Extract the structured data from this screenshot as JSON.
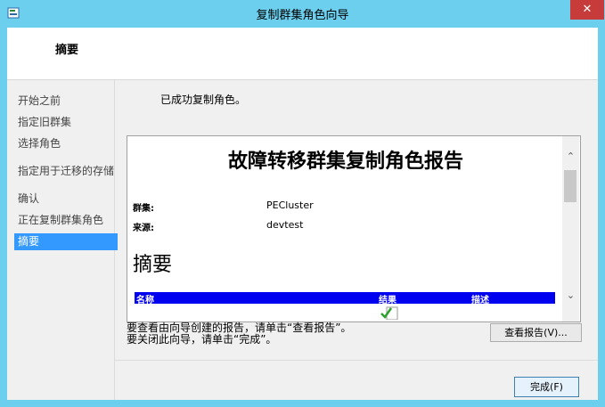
{
  "window": {
    "title": "复制群集角色向导",
    "close_glyph": "✕",
    "icon": "wizard-app-icon"
  },
  "header": {
    "title": "摘要"
  },
  "nav": {
    "items": [
      {
        "label": "开始之前",
        "active": false
      },
      {
        "label": "指定旧群集",
        "active": false
      },
      {
        "label": "选择角色",
        "active": false
      },
      {
        "label": "指定用于迁移的存储",
        "active": false
      },
      {
        "label": "确认",
        "active": false
      },
      {
        "label": "正在复制群集角色",
        "active": false
      },
      {
        "label": "摘要",
        "active": true
      }
    ]
  },
  "main": {
    "status_text": "已成功复制角色。",
    "report": {
      "title": "故障转移群集复制角色报告",
      "cluster_label": "群集:",
      "cluster_value": "PECluster",
      "source_label": "来源:",
      "source_value": "devtest",
      "section_title": "摘要",
      "table_headers": [
        "名称",
        "结果",
        "描述"
      ]
    },
    "hint_line1": "要查看由向导创建的报告，请单击“查看报告”。",
    "hint_line2": "要关闭此向导，请单击“完成”。",
    "view_report_button": "查看报告(V)...",
    "finish_button": "完成(F)"
  },
  "colors": {
    "titlebar": "#6ccfee",
    "close": "#c73b3b",
    "nav_active": "#3399ff",
    "table_header": "#0000f0"
  }
}
